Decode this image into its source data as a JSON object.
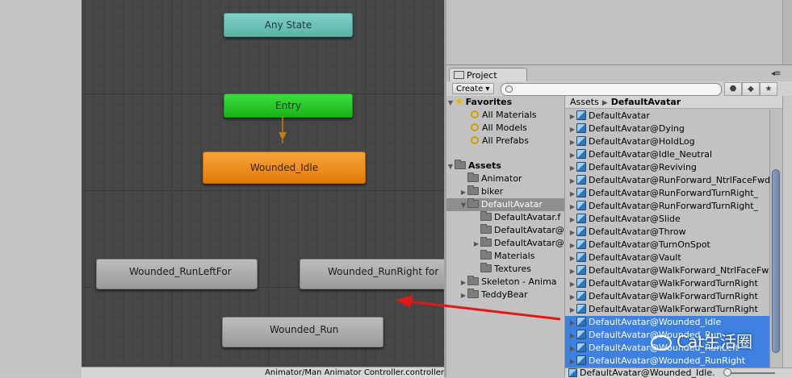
{
  "graph": {
    "nodes": {
      "any_state": "Any State",
      "entry": "Entry",
      "wounded_idle": "Wounded_Idle",
      "run_left": "Wounded_RunLeftFor",
      "run_right": "Wounded_RunRight for",
      "run": "Wounded_Run"
    },
    "status_path": "Animator/Man Animator Controller.controller"
  },
  "project": {
    "tab_label": "Project",
    "create_label": "Create ▾",
    "search_placeholder": "",
    "folders": {
      "favorites_label": "Favorites",
      "favorites": [
        "All Materials",
        "All Models",
        "All Prefabs"
      ],
      "assets_label": "Assets",
      "assets": [
        {
          "label": "Animator",
          "expand": ""
        },
        {
          "label": "biker",
          "expand": "▶"
        },
        {
          "label": "DefaultAvatar",
          "expand": "▼"
        },
        {
          "label": "DefaultAvatar.f",
          "expand": ""
        },
        {
          "label": "DefaultAvatar@",
          "expand": ""
        },
        {
          "label": "DefaultAvatar@",
          "expand": "▶"
        },
        {
          "label": "Materials",
          "expand": ""
        },
        {
          "label": "Textures",
          "expand": ""
        },
        {
          "label": "Skeleton - Anima",
          "expand": "▶"
        },
        {
          "label": "TeddyBear",
          "expand": "▶"
        }
      ]
    },
    "breadcrumb": {
      "root": "Assets",
      "current": "DefaultAvatar"
    },
    "files": [
      "DefaultAvatar",
      "DefaultAvatar@Dying",
      "DefaultAvatar@HoldLog",
      "DefaultAvatar@Idle_Neutral",
      "DefaultAvatar@Reviving",
      "DefaultAvatar@RunForward_NtrlFaceFwd",
      "DefaultAvatar@RunForwardTurnRight_",
      "DefaultAvatar@RunForwardTurnRight_",
      "DefaultAvatar@Slide",
      "DefaultAvatar@Throw",
      "DefaultAvatar@TurnOnSpot",
      "DefaultAvatar@Vault",
      "DefaultAvatar@WalkForward_NtrlFaceFwd",
      "DefaultAvatar@WalkForwardTurnRight",
      "DefaultAvatar@WalkForwardTurnRight",
      "DefaultAvatar@WalkForwardTurnRight",
      "DefaultAvatar@Wounded_Idle",
      "DefaultAvatar@Wounded_Run",
      "DefaultAvatar@Wounded_RunLeft",
      "DefaultAvatar@Wounded_RunRight"
    ],
    "selected_count": 4,
    "bottom_selection": "DefaultAvatar@Wounded_Idle."
  },
  "watermark": "Cat生活圈",
  "colors": {
    "selection": "#3d80df",
    "default_state": "#f08e1a",
    "entry": "#22c322",
    "any_state": "#6cc2b9"
  }
}
